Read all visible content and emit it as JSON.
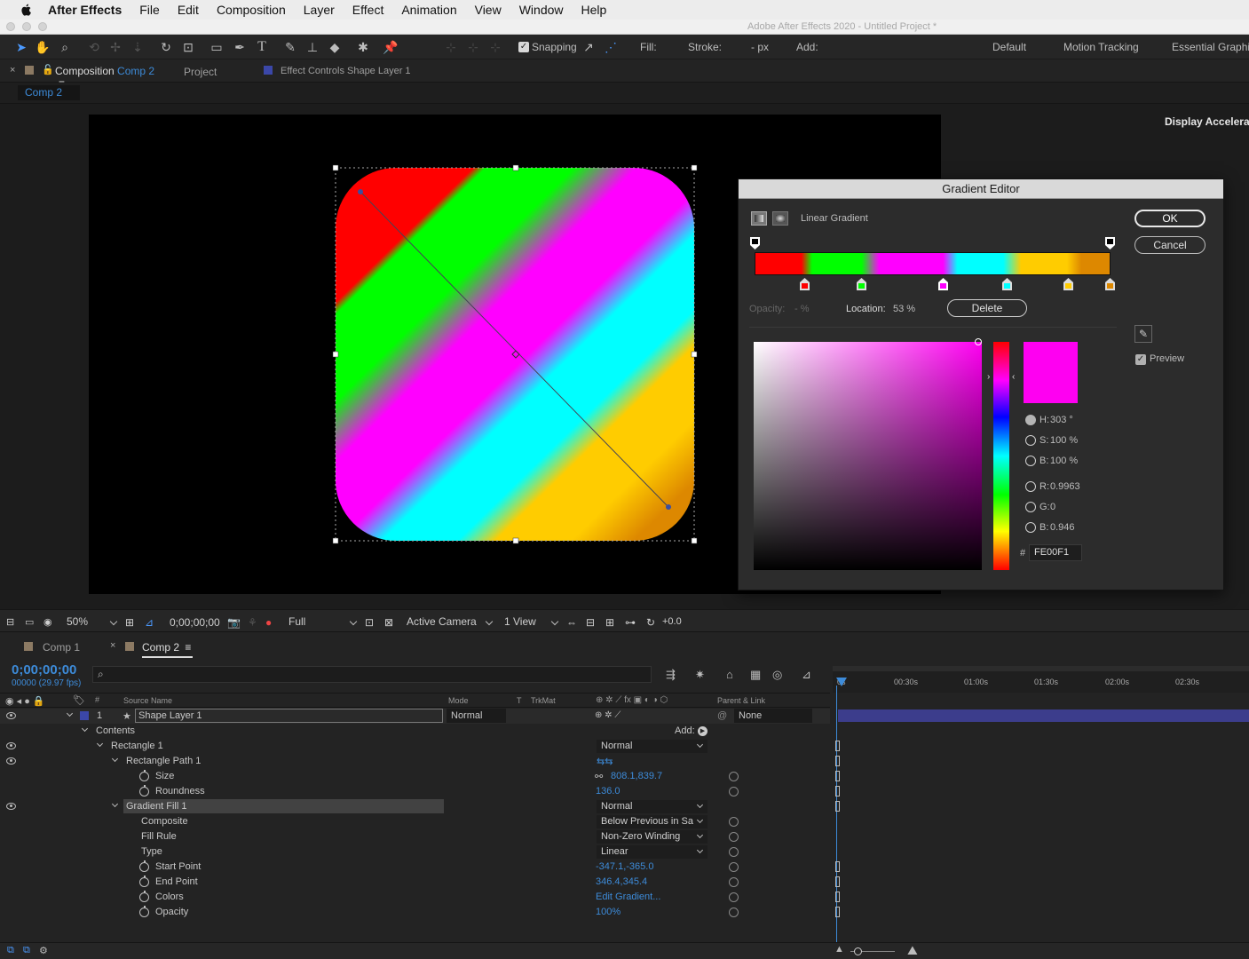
{
  "menubar": {
    "app_name": "After Effects",
    "items": [
      "File",
      "Edit",
      "Composition",
      "Layer",
      "Effect",
      "Animation",
      "View",
      "Window",
      "Help"
    ]
  },
  "window_title": "Adobe After Effects 2020 - Untitled Project *",
  "toolbar": {
    "snapping_label": "Snapping",
    "fill_label": "Fill:",
    "stroke_label": "Stroke:",
    "stroke_value": "?",
    "px_label": "- px",
    "add_label": "Add:",
    "workspaces": [
      "Default",
      "Motion Tracking",
      "Essential Graphics"
    ]
  },
  "panel_tabs": {
    "composition_prefix": "Composition",
    "composition_name": "Comp 2",
    "project": "Project",
    "effect_controls": "Effect Controls Shape Layer 1"
  },
  "comp_breadcrumb": "Comp 2",
  "display_acceleration": "Display Accelerati",
  "gradient_editor": {
    "title": "Gradient Editor",
    "type_label": "Linear Gradient",
    "ok_label": "OK",
    "cancel_label": "Cancel",
    "opacity_label": "Opacity:",
    "opacity_value": "- %",
    "location_label": "Location:",
    "location_value": "53 %",
    "delete_label": "Delete",
    "preview_label": "Preview",
    "h_label": "H:",
    "h_value": "303 °",
    "s_label": "S:",
    "s_value": "100 %",
    "b_label": "B:",
    "b_value": "100 %",
    "r_label": "R:",
    "r_value": "0.9963",
    "g_label": "G:",
    "g_value": "0",
    "b2_label": "B:",
    "b2_value": "0.946",
    "hex_label": "#",
    "hex_value": "FE00F1",
    "stops": [
      "#ff0000",
      "#00ff00",
      "#ff00ff",
      "#00ffff",
      "#ffcc00",
      "#dd8800"
    ],
    "selected_color": "#fe00f1"
  },
  "viewer_footer": {
    "zoom": "50%",
    "timecode": "0;00;00;00",
    "resolution": "Full",
    "camera": "Active Camera",
    "views": "1 View",
    "exposure": "+0.0"
  },
  "timeline": {
    "tabs": [
      "Comp 1",
      "Comp 2"
    ],
    "current_time": "0;00;00;00",
    "frame_info": "00000 (29.97 fps)",
    "search_placeholder": "",
    "columns": {
      "number": "#",
      "source_name": "Source Name",
      "mode": "Mode",
      "t": "T",
      "trkmat": "TrkMat",
      "parent_link": "Parent & Link"
    },
    "ruler": [
      "0s",
      "00:30s",
      "01:00s",
      "01:30s",
      "02:00s",
      "02:30s"
    ],
    "layer": {
      "number": "1",
      "name": "Shape Layer 1",
      "mode": "Normal",
      "parent": "None"
    },
    "contents_label": "Contents",
    "add_label": "Add:",
    "rect_label": "Rectangle 1",
    "rect_mode": "Normal",
    "rect_path_label": "Rectangle Path 1",
    "size_label": "Size",
    "size_value": "808.1,839.7",
    "roundness_label": "Roundness",
    "roundness_value": "136.0",
    "gradfill_label": "Gradient Fill 1",
    "gradfill_mode": "Normal",
    "composite_label": "Composite",
    "composite_value": "Below Previous in Sa",
    "fillrule_label": "Fill Rule",
    "fillrule_value": "Non-Zero Winding",
    "type_label": "Type",
    "type_value": "Linear",
    "start_label": "Start Point",
    "start_value": "-347.1,-365.0",
    "end_label": "End Point",
    "end_value": "346.4,345.4",
    "colors_label": "Colors",
    "colors_value": "Edit Gradient...",
    "opacity_label": "Opacity",
    "opacity_value": "100%"
  }
}
